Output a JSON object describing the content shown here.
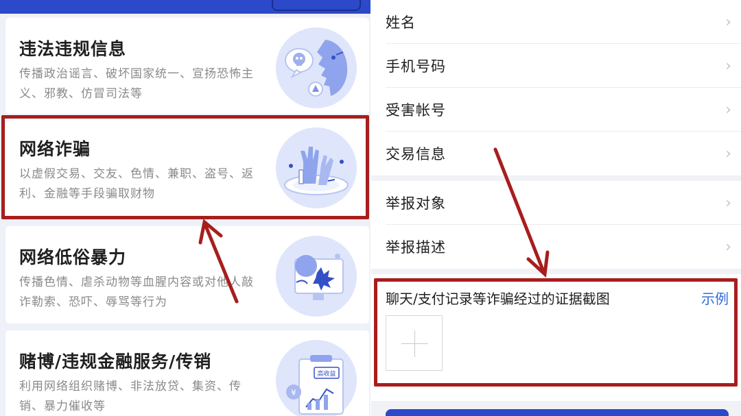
{
  "left_panel": {
    "cards": [
      {
        "title": "违法违规信息",
        "desc": "传播政治谣言、破坏国家统一、宣扬恐怖主义、邪教、仿冒司法等",
        "icon": "skull-face-icon"
      },
      {
        "title": "网络诈骗",
        "desc": "以虚假交易、交友、色情、兼职、盗号、返利、金融等手段骗取财物",
        "icon": "raised-hands-icon"
      },
      {
        "title": "网络低俗暴力",
        "desc": "传播色情、虐杀动物等血腥内容或对他人敲诈勒索、恐吓、辱骂等行为",
        "icon": "broken-screen-icon"
      },
      {
        "title": "赌博/违规金融服务/传销",
        "desc": "利用网络组织赌博、非法放贷、集资、传销、暴力催收等",
        "icon": "finance-chart-icon"
      }
    ],
    "art_badge": "高收益"
  },
  "right_panel": {
    "rows": [
      {
        "label": "姓名"
      },
      {
        "label": "手机号码"
      },
      {
        "label": "受害帐号"
      },
      {
        "label": "交易信息"
      },
      {
        "label": "举报对象"
      },
      {
        "label": "举报描述"
      }
    ],
    "chevron": "›",
    "evidence": {
      "label": "聊天/支付记录等诈骗经过的证据截图",
      "example_link": "示例",
      "upload_icon": "plus-icon"
    }
  },
  "colors": {
    "highlight": "#a81d1d",
    "brand_blue": "#2b49c9",
    "link_blue": "#2f6bde",
    "illustration_bg": "#dfe6fb"
  }
}
